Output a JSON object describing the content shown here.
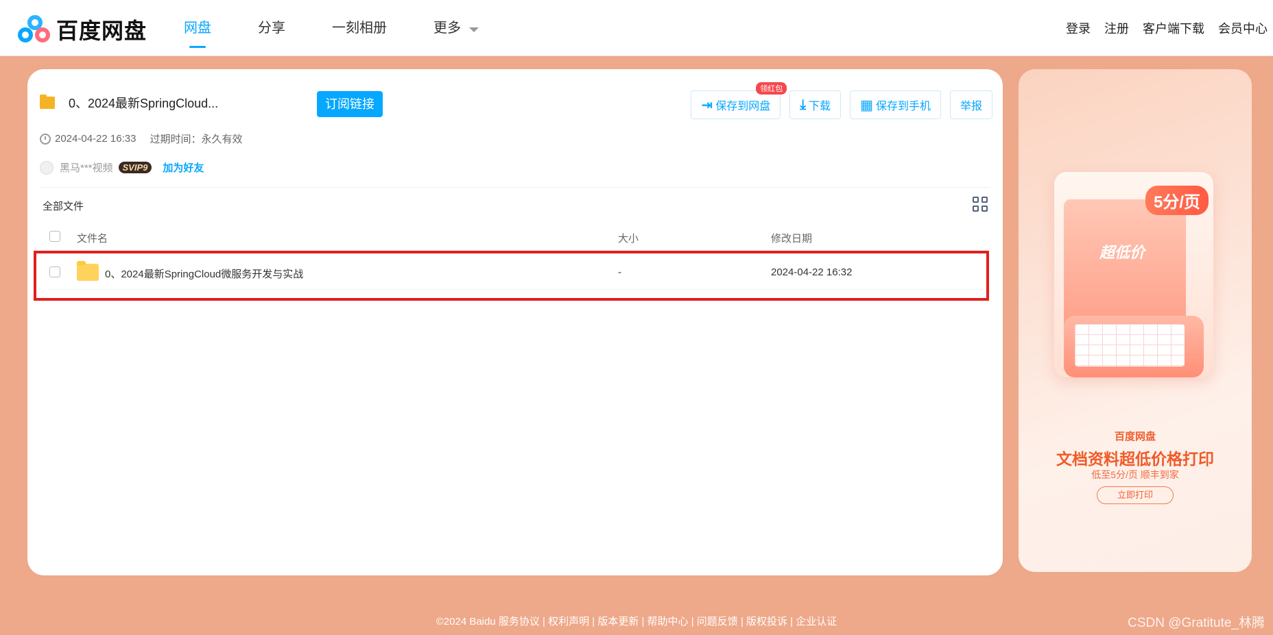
{
  "header": {
    "logo_text": "百度网盘",
    "nav": [
      {
        "label": "网盘",
        "active": true
      },
      {
        "label": "分享"
      },
      {
        "label": "一刻相册"
      },
      {
        "label": "更多"
      }
    ],
    "right_links": [
      "登录",
      "注册",
      "客户端下载",
      "会员中心"
    ]
  },
  "share": {
    "title": "0、2024最新SpringCloud...",
    "subscribe_label": "订阅链接",
    "actions": {
      "save_to_disk": "保存到网盘",
      "save_badge": "领红包",
      "download": "下载",
      "save_to_phone": "保存到手机",
      "report": "举报"
    },
    "date": "2024-04-22 16:33",
    "expire": "过期时间：永久有效",
    "owner": "黑马***视频",
    "vip": "SVIP9",
    "add_friend": "加为好友"
  },
  "files": {
    "breadcrumb": "全部文件",
    "columns": {
      "name": "文件名",
      "size": "大小",
      "date": "修改日期"
    },
    "rows": [
      {
        "name": "0、2024最新SpringCloud微服务开发与实战",
        "size": "-",
        "date": "2024-04-22 16:32"
      }
    ]
  },
  "ad": {
    "price_tag": "5分/页",
    "low_price": "超低价",
    "brand": "百度网盘",
    "headline": "文档资料超低价格打印",
    "sub": "低至5分/页 顺丰到家",
    "button": "立即打印"
  },
  "footer": {
    "text": "©2024 Baidu  服务协议 | 权利声明 | 版本更新 | 帮助中心 | 问题反馈 | 版权投诉 | 企业认证"
  },
  "watermark": "CSDN @Gratitute_林腾",
  "colors": {
    "accent": "#06a7ff",
    "background": "#eea88a",
    "highlight": "#e02020"
  }
}
